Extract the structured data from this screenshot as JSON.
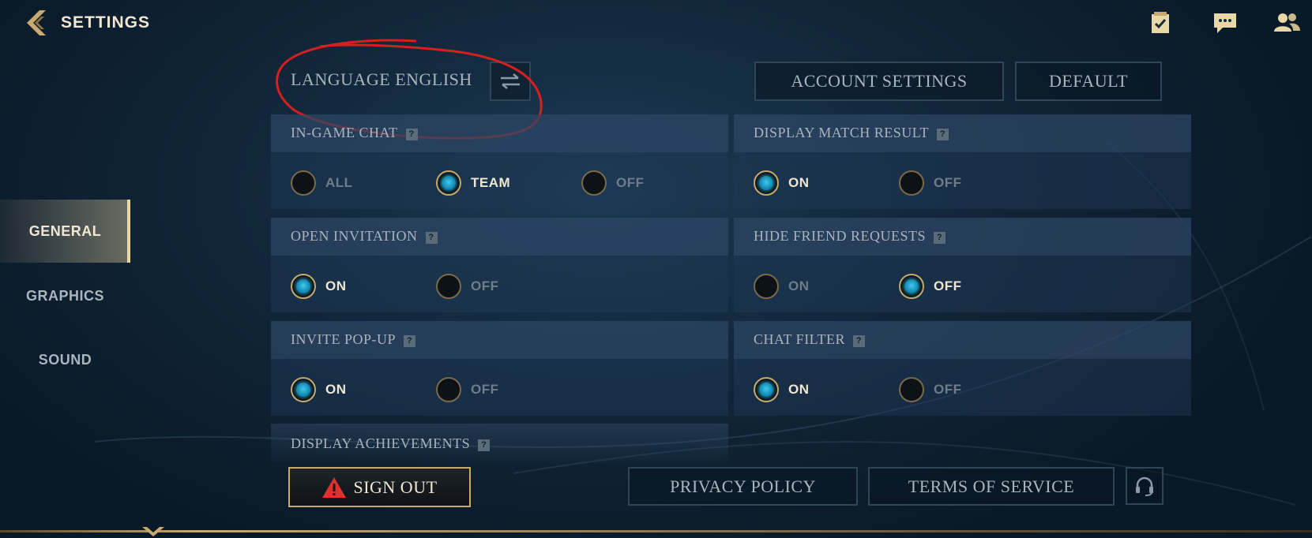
{
  "header": {
    "title": "SETTINGS",
    "icons": [
      "back-chevron-icon",
      "checklist-icon",
      "chat-icon",
      "friends-icon"
    ]
  },
  "sidebar": {
    "items": [
      {
        "label": "GENERAL",
        "active": true
      },
      {
        "label": "GRAPHICS",
        "active": false
      },
      {
        "label": "SOUND",
        "active": false
      }
    ]
  },
  "language": {
    "label": "LANGUAGE ENGLISH",
    "swap_icon": "swap-arrows-icon"
  },
  "top_buttons": {
    "account": "ACCOUNT SETTINGS",
    "default": "DEFAULT"
  },
  "settings": {
    "ingame_chat": {
      "label": "IN-GAME CHAT",
      "help": "?",
      "options": [
        "ALL",
        "TEAM",
        "OFF"
      ],
      "selected": "TEAM"
    },
    "display_match_result": {
      "label": "DISPLAY MATCH RESULT",
      "help": "?",
      "options": [
        "ON",
        "OFF"
      ],
      "selected": "ON"
    },
    "open_invitation": {
      "label": "OPEN INVITATION",
      "help": "?",
      "options": [
        "ON",
        "OFF"
      ],
      "selected": "ON"
    },
    "hide_friend_requests": {
      "label": "HIDE FRIEND REQUESTS",
      "help": "?",
      "options": [
        "ON",
        "OFF"
      ],
      "selected": "OFF"
    },
    "invite_popup": {
      "label": "INVITE POP-UP",
      "help": "?",
      "options": [
        "ON",
        "OFF"
      ],
      "selected": "ON"
    },
    "chat_filter": {
      "label": "CHAT FILTER",
      "help": "?",
      "options": [
        "ON",
        "OFF"
      ],
      "selected": "ON"
    },
    "display_achievements": {
      "label": "DISPLAY ACHIEVEMENTS",
      "help": "?"
    }
  },
  "footer": {
    "sign_out": "SIGN OUT",
    "privacy": "PRIVACY POLICY",
    "terms": "TERMS OF SERVICE",
    "support_icon": "headset-icon"
  },
  "colors": {
    "gold": "#c8aa6e",
    "cream": "#f0e6d2",
    "blue_dot": "#29b6dd",
    "annotation_red": "#d42020",
    "warning_red": "#e03030"
  }
}
